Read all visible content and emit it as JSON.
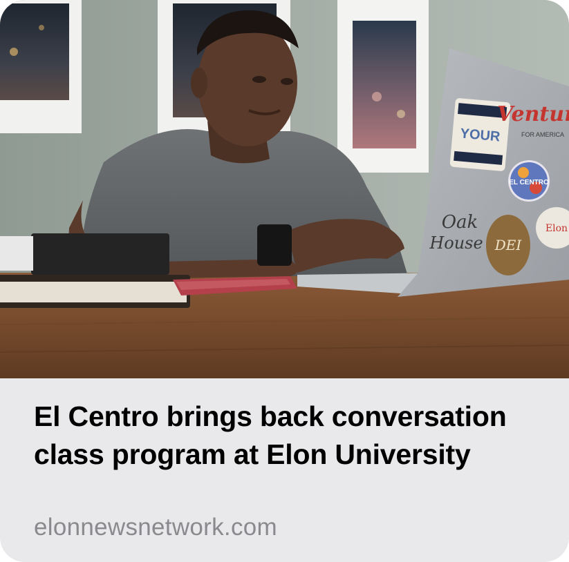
{
  "link_preview": {
    "image": {
      "alt": "Student working on a laptop covered in stickers at a wooden table",
      "stickers": [
        "Venture FOR AMERICA",
        "YOUR",
        "EL CENTRO",
        "Oak House",
        "DEI"
      ]
    },
    "headline": "El Centro brings back conversation class program at Elon University",
    "domain": "elonnewsnetwork.com"
  },
  "colors": {
    "caption_background": "#e9e9eb",
    "headline_text": "#000000",
    "domain_text": "#8a8a8e"
  }
}
